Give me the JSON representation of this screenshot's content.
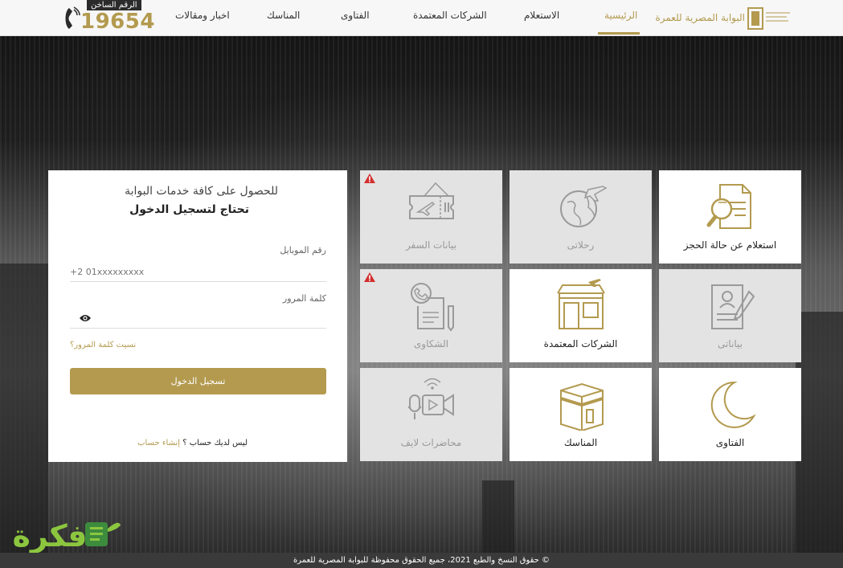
{
  "brand": {
    "name": "البوابة المصرية للعمرة"
  },
  "nav": [
    {
      "label": "الرئيسية",
      "active": true
    },
    {
      "label": "الاستعلام",
      "active": false
    },
    {
      "label": "الشركات المعتمدة",
      "active": false
    },
    {
      "label": "الفتاوى",
      "active": false
    },
    {
      "label": "المناسك",
      "active": false
    },
    {
      "label": "اخبار ومقالات",
      "active": false
    }
  ],
  "hotline": {
    "label": "الرقم الساخن",
    "number": "19654"
  },
  "login": {
    "heading": "للحصول على كافة خدمات البوابة",
    "subheading": "تحتاج لتسجيل الدخول",
    "mobile_label": "رقم الموبايل",
    "mobile_placeholder": "+2 01xxxxxxxxx",
    "password_label": "كلمة المرور",
    "forgot": "نسيت كلمة المرور؟",
    "submit": "تسجيل الدخول",
    "no_account": "ليس لديك حساب ؟",
    "create_account": "إنشاء حساب"
  },
  "tiles": [
    {
      "label": "استعلام عن حالة الحجز",
      "icon": "booking-search-icon",
      "disabled": false
    },
    {
      "label": "رحلاتى",
      "icon": "globe-plane-icon",
      "disabled": true
    },
    {
      "label": "بيانات السفر",
      "icon": "travel-ticket-icon",
      "disabled": true,
      "warning": true
    },
    {
      "label": "بياناتى",
      "icon": "profile-document-icon",
      "disabled": true
    },
    {
      "label": "الشركات المعتمدة",
      "icon": "agency-office-icon",
      "disabled": false
    },
    {
      "label": "الشكاوى",
      "icon": "complaint-phone-icon",
      "disabled": true,
      "warning": true
    },
    {
      "label": "الفتاوى",
      "icon": "crescent-moon-icon",
      "disabled": false
    },
    {
      "label": "المناسك",
      "icon": "kaaba-icon",
      "disabled": false
    },
    {
      "label": "محاضرات لايف",
      "icon": "live-lecture-icon",
      "disabled": true
    }
  ],
  "footer": {
    "text": "© حقوق النسخ والطبع 2021، جميع الحقوق محفوظة للبوابة المصرية للعمرة"
  },
  "watermark": {
    "text": "فكرة"
  },
  "colors": {
    "accent": "#b39a4f",
    "tile_disabled": "#e3e3e3",
    "warning": "#d32f2f"
  }
}
